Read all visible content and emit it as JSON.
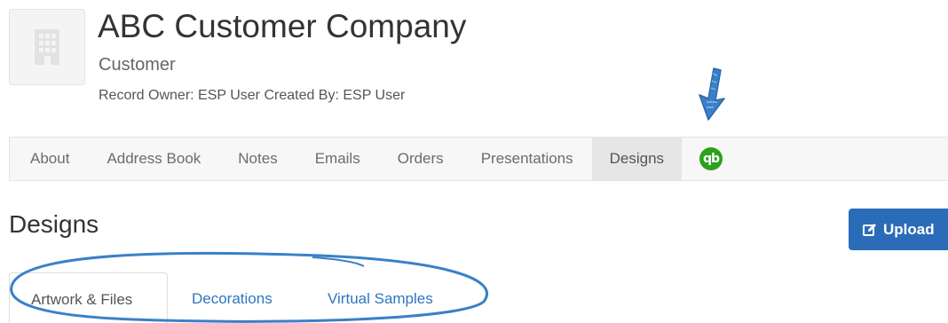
{
  "header": {
    "company_name": "ABC Customer Company",
    "company_type": "Customer",
    "record_meta": "Record Owner: ESP User  Created By: ESP User",
    "avatar_icon": "building-icon"
  },
  "nav": {
    "items": [
      {
        "label": "About"
      },
      {
        "label": "Address Book"
      },
      {
        "label": "Notes"
      },
      {
        "label": "Emails"
      },
      {
        "label": "Orders"
      },
      {
        "label": "Presentations"
      },
      {
        "label": "Designs",
        "active": true
      }
    ],
    "quickbooks": {
      "label": "qb",
      "icon": "quickbooks-icon",
      "color": "#2ca01c"
    }
  },
  "section": {
    "title": "Designs",
    "upload_button": "Upload",
    "upload_icon": "edit-icon"
  },
  "tabs": [
    {
      "label": "Artwork & Files",
      "active": true
    },
    {
      "label": "Decorations"
    },
    {
      "label": "Virtual Samples"
    }
  ],
  "colors": {
    "accent": "#2b6cb8",
    "link": "#2f75c0",
    "annotation": "#3a80c8",
    "quickbooks": "#2ca01c"
  }
}
